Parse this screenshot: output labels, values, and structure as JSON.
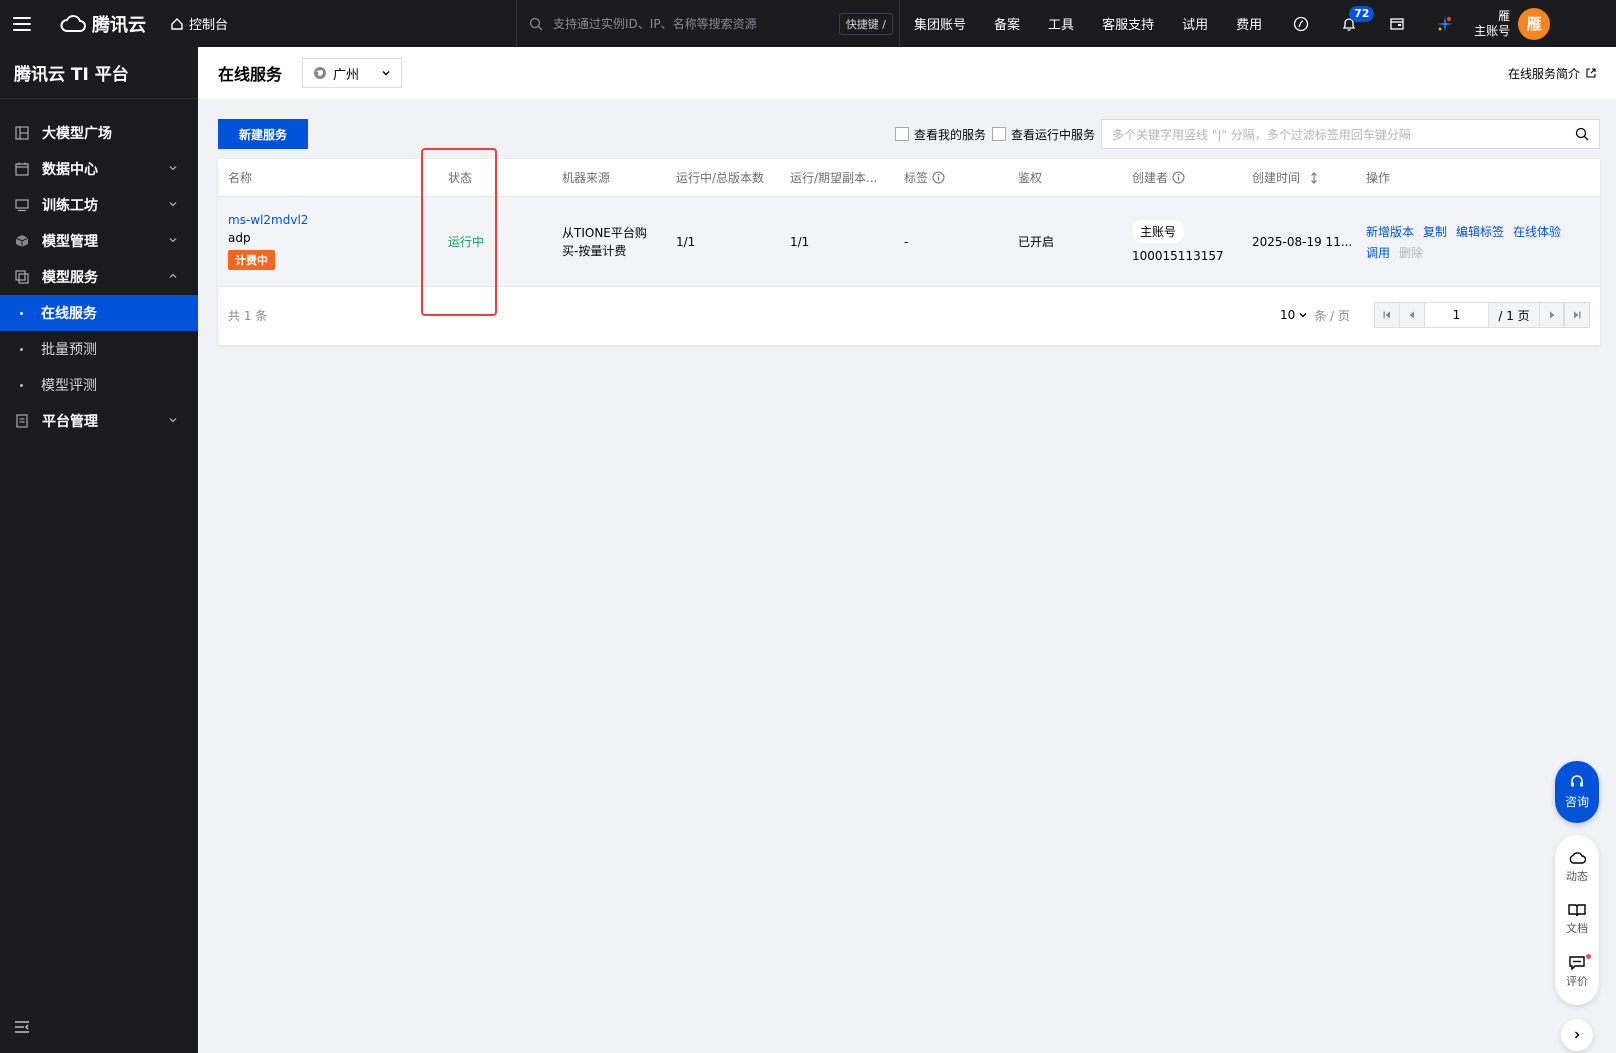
{
  "topbar": {
    "logo_text": "腾讯云",
    "console_label": "控制台",
    "search_placeholder": "支持通过实例ID、IP、名称等搜索资源",
    "hotkey_label": "快捷键 /",
    "nav": [
      "集团账号",
      "备案",
      "工具",
      "客服支持",
      "试用",
      "费用"
    ],
    "notification_count": "72",
    "user_name": "雁",
    "user_role": "主账号",
    "avatar_text": "雁"
  },
  "sidebar": {
    "title": "腾讯云 TI 平台",
    "items": [
      {
        "label": "大模型广场",
        "icon": "dashboard-icon"
      },
      {
        "label": "数据中心",
        "icon": "calendar-icon"
      },
      {
        "label": "训练工坊",
        "icon": "monitor-icon"
      },
      {
        "label": "模型管理",
        "icon": "cube-icon"
      },
      {
        "label": "模型服务",
        "icon": "layers-icon"
      }
    ],
    "subitems": [
      "在线服务",
      "批量预测",
      "模型评测"
    ],
    "last_item": {
      "label": "平台管理",
      "icon": "document-icon"
    }
  },
  "page": {
    "title": "在线服务",
    "region": "广州",
    "intro_link": "在线服务简介"
  },
  "toolbar": {
    "new_button": "新建服务",
    "check_mine": "查看我的服务",
    "check_running": "查看运行中服务",
    "search_placeholder": "多个关键字用竖线 \"|\" 分隔，多个过滤标签用回车键分隔"
  },
  "table": {
    "headers": [
      "名称",
      "状态",
      "机器来源",
      "运行中/总版本数",
      "运行/期望副本...",
      "标签",
      "鉴权",
      "创建者",
      "创建时间",
      "操作"
    ],
    "row": {
      "name": "ms-wl2mdvl2",
      "subname": "adp",
      "billing_tag": "计费中",
      "status": "运行中",
      "machine_source": "从TIONE平台购买-按量计费",
      "versions": "1/1",
      "replicas": "1/1",
      "tags": "-",
      "auth": "已开启",
      "creator_tag": "主账号",
      "creator_id": "100015113157",
      "created_time": "2025-08-19 11...",
      "ops": [
        "新增版本",
        "复制",
        "编辑标签",
        "在线体验",
        "调用"
      ],
      "op_disabled": "删除"
    },
    "footer": {
      "total": "共 1 条",
      "page_size": "10",
      "page_unit": "条 / 页",
      "current_page": "1",
      "total_pages": "/ 1 页"
    }
  },
  "float": {
    "consult": "咨询",
    "items": [
      "动态",
      "文档",
      "评价"
    ]
  },
  "colors": {
    "primary": "#0052d9",
    "topbar_bg": "#1b1b1d",
    "status_green": "#18a058",
    "billing_orange": "#f5661f",
    "highlight_red": "#ef3c3c"
  }
}
